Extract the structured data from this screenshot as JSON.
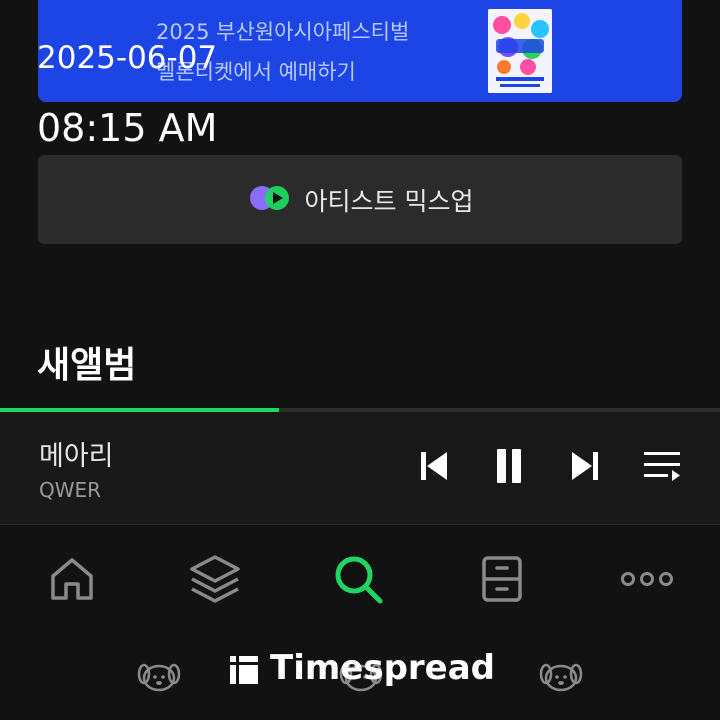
{
  "banner": {
    "line1": "2025 부산원아시아페스티벌",
    "line2": "멜론티켓에서 예매하기",
    "poster_icon": "festival-poster"
  },
  "overlay": {
    "date": "2025-06-07",
    "time": "08:15 AM"
  },
  "mixup": {
    "label": "아티스트 믹스업",
    "icon": "mixup-play-icon"
  },
  "section": {
    "title": "새앨범"
  },
  "player": {
    "progress": 0.387,
    "title": "메아리",
    "artist": "QWER",
    "controls": [
      "previous-icon",
      "pause-icon",
      "next-icon",
      "playlist-icon"
    ]
  },
  "nav": {
    "items": [
      "home-icon",
      "library-icon",
      "search-icon",
      "storage-icon",
      "more-icon"
    ],
    "active": "search-icon",
    "accent": "#1ed760"
  },
  "watermark": {
    "text": "Timespread",
    "icon": "timespread-logo-icon"
  },
  "colors": {
    "background": "#121212",
    "banner": "#1d45e6",
    "accent": "#1ed760"
  }
}
